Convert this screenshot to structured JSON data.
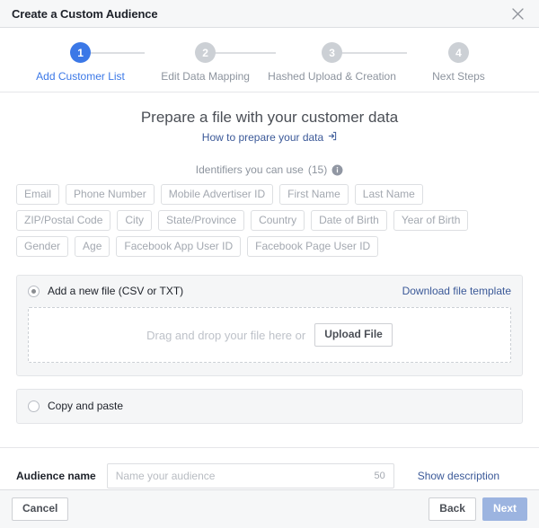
{
  "window": {
    "title": "Create a Custom Audience",
    "close_icon": "close-icon"
  },
  "stepper": {
    "steps": [
      {
        "number": "1",
        "label": "Add Customer List",
        "state": "active"
      },
      {
        "number": "2",
        "label": "Edit Data Mapping",
        "state": "inactive"
      },
      {
        "number": "3",
        "label": "Hashed Upload & Creation",
        "state": "inactive"
      },
      {
        "number": "4",
        "label": "Next Steps",
        "state": "inactive"
      }
    ],
    "active_color": "#3b78e7",
    "inactive_color": "#ccd0d5"
  },
  "main": {
    "heading": "Prepare a file with your customer data",
    "help_link": "How to prepare your data",
    "help_link_icon": "external-link-icon",
    "identifiers_label": "Identifiers you can use",
    "identifiers_count": "(15)",
    "identifiers_info_icon": "info-icon",
    "identifiers": [
      "Email",
      "Phone Number",
      "Mobile Advertiser ID",
      "First Name",
      "Last Name",
      "ZIP/Postal Code",
      "City",
      "State/Province",
      "Country",
      "Date of Birth",
      "Year of Birth",
      "Gender",
      "Age",
      "Facebook App User ID",
      "Facebook Page User ID"
    ]
  },
  "file_option": {
    "label": "Add a new file (CSV or TXT)",
    "selected": true,
    "download_template_link": "Download file template",
    "dropzone_text": "Drag and drop your file here or",
    "upload_button": "Upload File"
  },
  "paste_option": {
    "label": "Copy and paste",
    "selected": false
  },
  "audience_name": {
    "label": "Audience name",
    "value": "",
    "placeholder": "Name your audience",
    "char_limit": "50",
    "show_description_link": "Show description"
  },
  "footer": {
    "cancel_label": "Cancel",
    "back_label": "Back",
    "next_label": "Next",
    "next_color": "#9cb4e0"
  },
  "colors": {
    "link_blue": "#3b5998",
    "accent_blue": "#3b78e7",
    "panel_bg": "#f5f6f7",
    "chrome_bg": "#f6f7f8",
    "border": "#dddfe2"
  }
}
